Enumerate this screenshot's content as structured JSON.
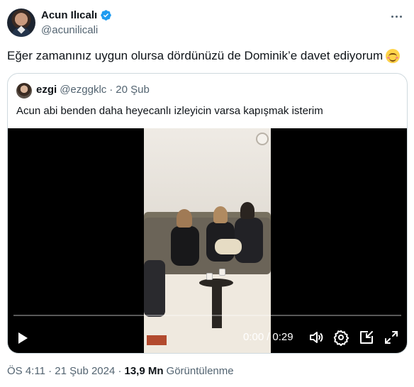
{
  "author": {
    "display_name": "Acun Ilıcalı",
    "handle": "@acunilicali",
    "verified_icon": "verified-badge-icon"
  },
  "tweet": {
    "text": "Eğer zamanınız uygun olursa dördünüzü de Dominik’e davet ediyorum",
    "emoji_icon": "smiling-face-with-smiling-eyes-icon"
  },
  "quote": {
    "display_name": "ezgi",
    "handle": "@ezggklc",
    "separator": "·",
    "date": "20 Şub",
    "text": "Acun abi benden daha heyecanlı izleyicin varsa kapışmak isterim"
  },
  "video": {
    "current_time": "0:00",
    "separator": "/",
    "duration": "0:29",
    "progress": 0.0
  },
  "meta": {
    "timestamp": "ÖS 4:11 · 21 Şub 2024 ·",
    "views_count": "13,9 Mn",
    "views_label": "Görüntülenme"
  },
  "colors": {
    "text_primary": "#0f1419",
    "text_secondary": "#536471",
    "verified_blue": "#1d9bf0",
    "border": "#cfd9de"
  }
}
